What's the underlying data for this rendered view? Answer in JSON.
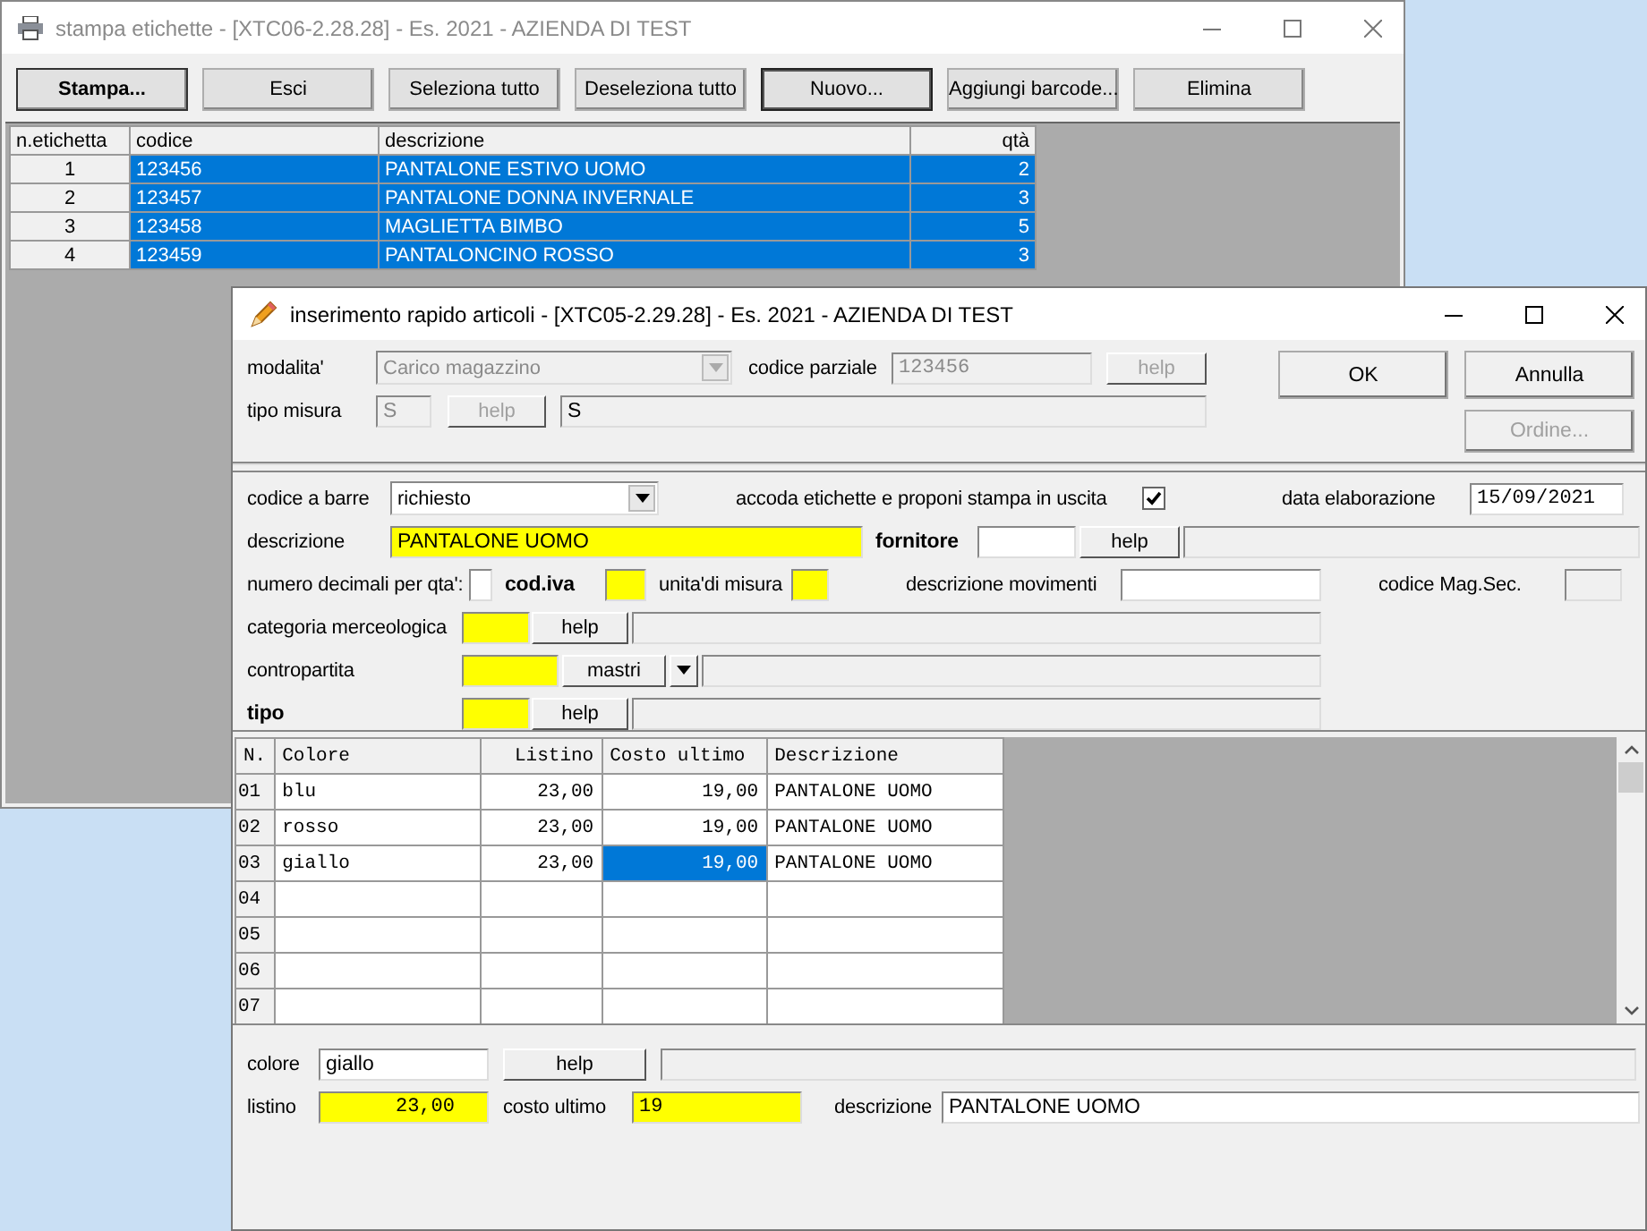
{
  "back_window": {
    "title": "stampa etichette - [XTC06-2.28.28] - Es. 2021 - AZIENDA DI TEST",
    "buttons": [
      {
        "label": "Stampa...",
        "default": true,
        "focused": false
      },
      {
        "label": "Esci",
        "default": false,
        "focused": false
      },
      {
        "label": "Seleziona tutto",
        "default": false,
        "focused": false
      },
      {
        "label": "Deseleziona tutto",
        "default": false,
        "focused": false
      },
      {
        "label": "Nuovo...",
        "default": false,
        "focused": true
      },
      {
        "label": "Aggiungi barcode...",
        "default": false,
        "focused": false
      },
      {
        "label": "Elimina",
        "default": false,
        "focused": false
      }
    ],
    "table": {
      "columns": [
        "n.etichetta",
        "codice",
        "descrizione",
        "qtà"
      ],
      "rows": [
        {
          "cells": [
            "1",
            "123456",
            "PANTALONE ESTIVO UOMO",
            "2"
          ],
          "selected": true
        },
        {
          "cells": [
            "2",
            "123457",
            "PANTALONE DONNA INVERNALE",
            "3"
          ],
          "selected": true
        },
        {
          "cells": [
            "3",
            "123458",
            "MAGLIETTA BIMBO",
            "5"
          ],
          "selected": true
        },
        {
          "cells": [
            "4",
            "123459",
            "PANTALONCINO ROSSO",
            "3"
          ],
          "selected": true
        }
      ]
    }
  },
  "front_window": {
    "title": "inserimento rapido articoli - [XTC05-2.29.28] - Es. 2021 - AZIENDA DI TEST",
    "actions": [
      {
        "label": "OK",
        "disabled": false
      },
      {
        "label": "Annulla",
        "disabled": false
      },
      {
        "label": "Ordine...",
        "disabled": true
      }
    ],
    "sections": [
      {
        "rows": [
          {
            "items": [
              {
                "kind": "label",
                "text": "modalita'"
              },
              {
                "kind": "dropdown",
                "value": "Carico magazzino",
                "disabled": true
              },
              {
                "kind": "label",
                "text": "codice parziale"
              },
              {
                "kind": "code_field",
                "value": "123456",
                "disabled": true,
                "required": false
              },
              {
                "kind": "button",
                "label": "help",
                "disabled": true
              }
            ]
          },
          {
            "items": [
              {
                "kind": "label",
                "text": "tipo misura"
              },
              {
                "kind": "field",
                "value": "S",
                "disabled": true,
                "required": false
              },
              {
                "kind": "button",
                "label": "help",
                "disabled": true
              },
              {
                "kind": "display",
                "value": "S"
              }
            ]
          }
        ]
      },
      {
        "rows": [
          {
            "items": [
              {
                "kind": "label",
                "text": "codice a barre"
              },
              {
                "kind": "dropdown",
                "value": "richiesto",
                "disabled": false
              },
              {
                "kind": "label",
                "text": "accoda etichette e proponi stampa in uscita"
              },
              {
                "kind": "checkbox",
                "checked": true
              },
              {
                "kind": "label",
                "text": "data elaborazione"
              },
              {
                "kind": "code_field",
                "value": "15/09/2021",
                "disabled": false,
                "required": false
              }
            ]
          },
          {
            "items": [
              {
                "kind": "label",
                "text": "descrizione"
              },
              {
                "kind": "field",
                "value": "PANTALONE UOMO",
                "disabled": false,
                "required": true
              },
              {
                "kind": "key_label",
                "text": "fornitore"
              },
              {
                "kind": "field",
                "disabled": false,
                "required": false
              },
              {
                "kind": "button",
                "label": "help",
                "disabled": false
              },
              {
                "kind": "display"
              }
            ]
          },
          {
            "items": [
              {
                "kind": "label",
                "text": "numero decimali per qta':"
              },
              {
                "kind": "field",
                "disabled": false,
                "required": false
              },
              {
                "kind": "key_label",
                "text": "cod.iva"
              },
              {
                "kind": "field",
                "disabled": false,
                "required": true
              },
              {
                "kind": "label",
                "text": "unita'di misura"
              },
              {
                "kind": "field",
                "disabled": false,
                "required": true
              },
              {
                "kind": "label",
                "text": "descrizione movimenti"
              },
              {
                "kind": "field",
                "disabled": false,
                "required": false
              },
              {
                "kind": "label",
                "text": "codice Mag.Sec."
              },
              {
                "kind": "field",
                "disabled": true,
                "required": false
              }
            ]
          },
          {
            "items": [
              {
                "kind": "label",
                "text": "categoria merceologica"
              },
              {
                "kind": "field",
                "disabled": false,
                "required": true
              },
              {
                "kind": "button",
                "label": "help",
                "disabled": false
              },
              {
                "kind": "display"
              }
            ]
          },
          {
            "items": [
              {
                "kind": "label",
                "text": "contropartita"
              },
              {
                "kind": "field",
                "disabled": false,
                "required": true
              },
              {
                "kind": "button",
                "label": "mastri",
                "disabled": false
              },
              {
                "kind": "arrow"
              },
              {
                "kind": "display"
              }
            ]
          },
          {
            "items": [
              {
                "kind": "key_label",
                "text": "tipo"
              },
              {
                "kind": "field",
                "disabled": false,
                "required": true
              },
              {
                "kind": "button",
                "label": "help",
                "disabled": false
              },
              {
                "kind": "display"
              }
            ]
          }
        ]
      },
      {
        "rows": [
          {
            "items": [
              {
                "kind": "label",
                "text": "colore"
              },
              {
                "kind": "field",
                "value": "giallo",
                "disabled": false,
                "required": false
              },
              {
                "kind": "button",
                "label": "help",
                "disabled": false
              },
              {
                "kind": "display"
              }
            ]
          },
          {
            "items": [
              {
                "kind": "label",
                "text": "listino"
              },
              {
                "kind": "amount_field",
                "value": "23,00",
                "disabled": false,
                "required": true
              },
              {
                "kind": "label",
                "text": "costo ultimo"
              },
              {
                "kind": "code_field",
                "value": "19",
                "disabled": false,
                "required": true
              },
              {
                "kind": "label",
                "text": "descrizione"
              },
              {
                "kind": "field",
                "value": "PANTALONE UOMO",
                "disabled": false,
                "required": false
              }
            ]
          }
        ]
      }
    ],
    "grid": {
      "columns": [
        "N.",
        "Colore",
        "Listino",
        "Costo ultimo",
        "Descrizione"
      ],
      "rows": [
        {
          "n": "01",
          "cells": [
            {
              "text": "blu",
              "selected": false
            },
            {
              "text": "23,00",
              "selected": false
            },
            {
              "text": "19,00",
              "selected": false
            },
            {
              "text": "PANTALONE UOMO",
              "selected": false
            }
          ]
        },
        {
          "n": "02",
          "cells": [
            {
              "text": "rosso",
              "selected": false
            },
            {
              "text": "23,00",
              "selected": false
            },
            {
              "text": "19,00",
              "selected": false
            },
            {
              "text": "PANTALONE UOMO",
              "selected": false
            }
          ]
        },
        {
          "n": "03",
          "cells": [
            {
              "text": "giallo",
              "selected": false
            },
            {
              "text": "23,00",
              "selected": false
            },
            {
              "text": "19,00",
              "selected": true
            },
            {
              "text": "PANTALONE UOMO",
              "selected": false
            }
          ]
        },
        {
          "n": "04"
        },
        {
          "n": "05"
        },
        {
          "n": "06"
        },
        {
          "n": "07"
        }
      ]
    }
  }
}
